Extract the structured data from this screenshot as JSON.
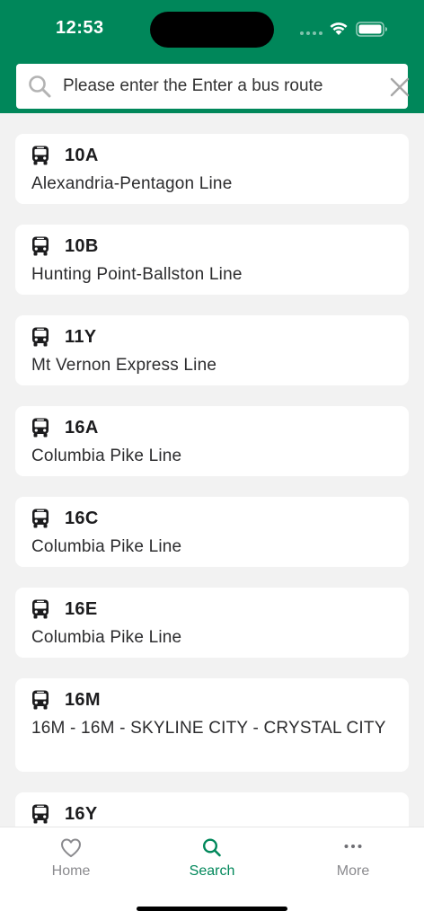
{
  "status_bar": {
    "time": "12:53"
  },
  "search": {
    "placeholder": "Please enter the Enter a bus route",
    "value": ""
  },
  "routes": [
    {
      "id": "10A",
      "name": "Alexandria-Pentagon Line"
    },
    {
      "id": "10B",
      "name": "Hunting Point-Ballston Line"
    },
    {
      "id": "11Y",
      "name": "Mt Vernon Express Line"
    },
    {
      "id": "16A",
      "name": "Columbia Pike Line"
    },
    {
      "id": "16C",
      "name": "Columbia Pike Line"
    },
    {
      "id": "16E",
      "name": "Columbia Pike Line"
    },
    {
      "id": "16M",
      "name": "16M - 16M - SKYLINE CITY - CRYSTAL CITY"
    },
    {
      "id": "16Y",
      "name": ""
    }
  ],
  "tabbar": {
    "home": "Home",
    "search": "Search",
    "more": "More",
    "active": "search"
  },
  "colors": {
    "brand": "#00875a",
    "background": "#f2f2f2"
  },
  "icons": {
    "route": "bus-icon",
    "search": "search-icon",
    "clear": "close-icon",
    "home": "heart-icon",
    "more": "ellipsis-icon"
  }
}
